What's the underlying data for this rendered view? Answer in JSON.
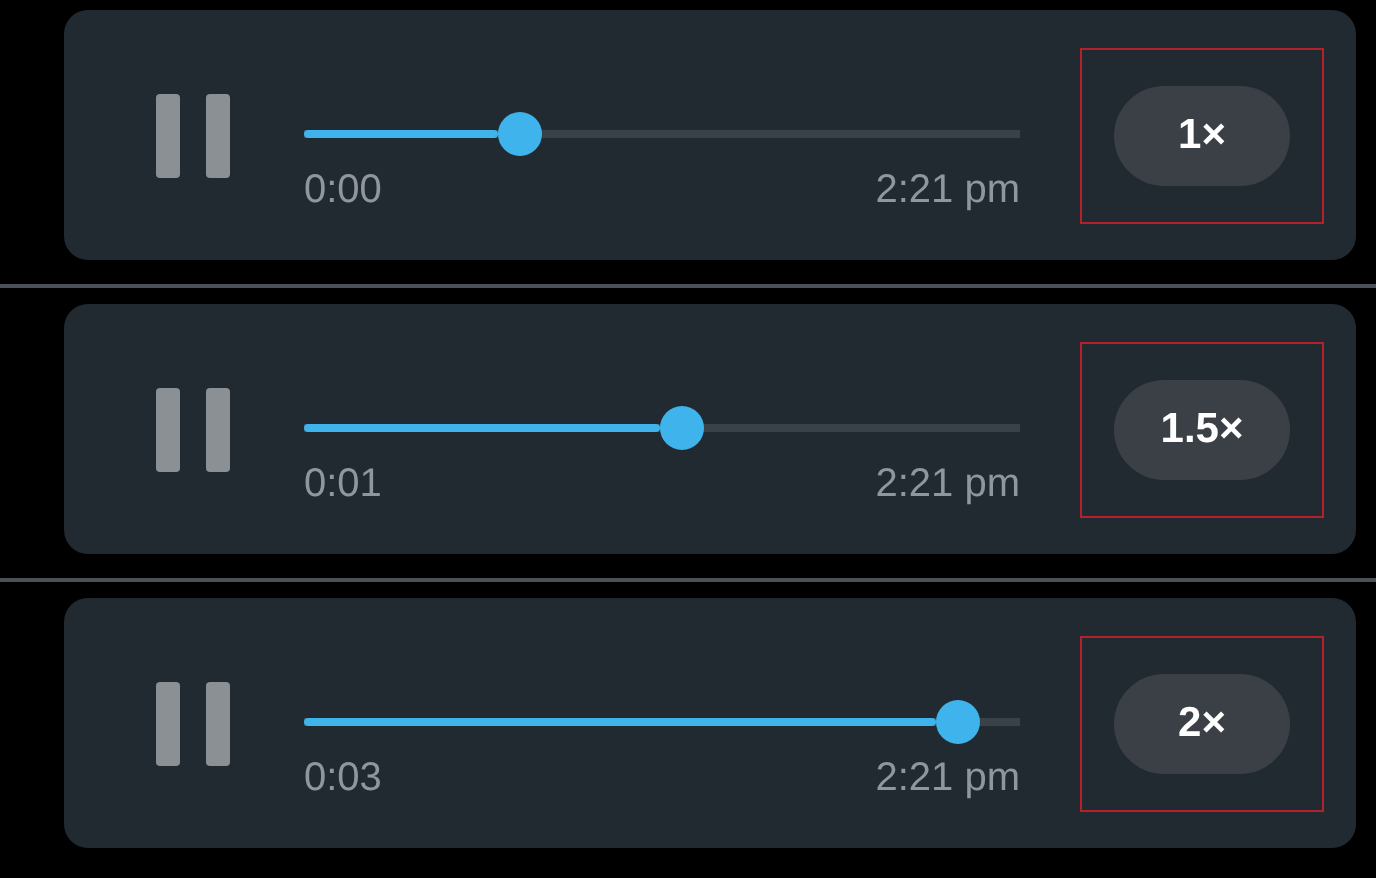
{
  "players": [
    {
      "elapsed": "0:00",
      "sent_time": "2:21 pm",
      "level": 0.29,
      "playing": true,
      "speed": "1×",
      "highlighted": true
    },
    {
      "elapsed": "0:01",
      "sent_time": "2:21 pm",
      "level": 0.53,
      "playing": true,
      "speed": "1.5×",
      "highlighted": true
    },
    {
      "elapsed": "0:03",
      "sent_time": "2:21 pm",
      "level": 0.94,
      "playing": true,
      "speed": "2×",
      "highlighted": true
    }
  ]
}
